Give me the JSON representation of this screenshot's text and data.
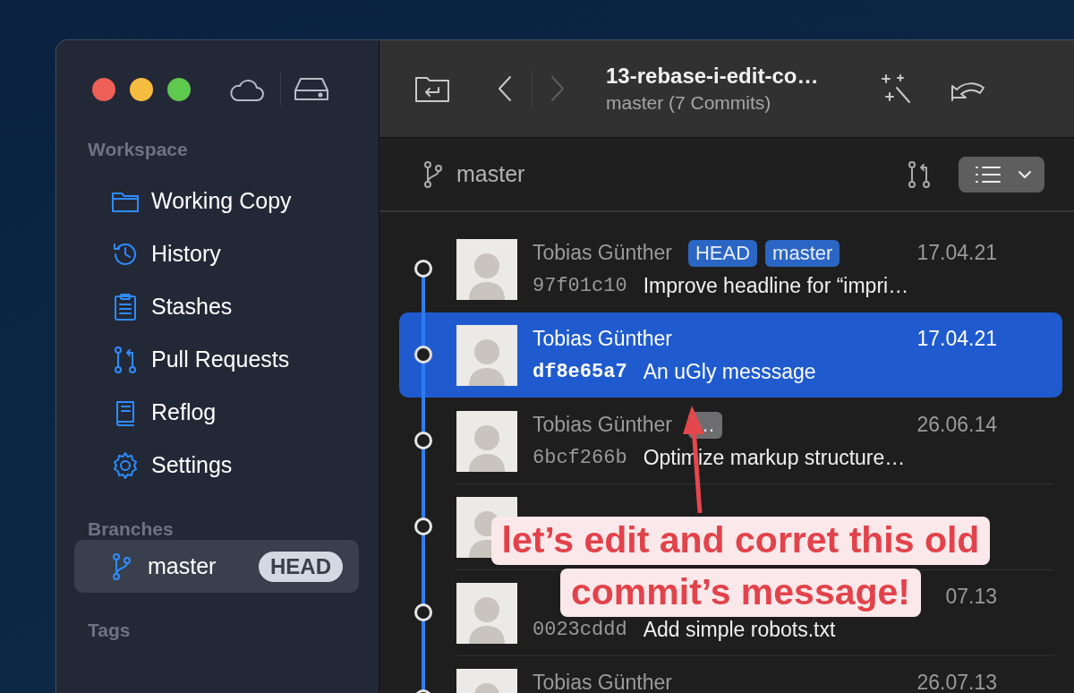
{
  "window": {
    "title": "13-rebase-i-edit-co…",
    "subtitle": "master (7 Commits)"
  },
  "toolbar": {
    "buttons": [
      {
        "kind": "folder-return"
      },
      {
        "kind": "back",
        "disabled": false
      },
      {
        "kind": "forward",
        "disabled": true
      },
      {
        "kind": "title"
      },
      {
        "kind": "magic"
      },
      {
        "kind": "undo"
      }
    ]
  },
  "sidebar": {
    "sections": [
      {
        "title": "Workspace",
        "items": [
          {
            "label": "Working Copy",
            "kind": "folder",
            "selected": false
          },
          {
            "label": "History",
            "kind": "history",
            "selected": false
          },
          {
            "label": "Stashes",
            "kind": "clipboard",
            "selected": false
          },
          {
            "label": "Pull Requests",
            "kind": "pull",
            "selected": false
          },
          {
            "label": "Reflog",
            "kind": "book",
            "selected": false
          },
          {
            "label": "Settings",
            "kind": "gear",
            "selected": false
          }
        ]
      },
      {
        "title": "Branches",
        "items": [
          {
            "label": "master",
            "kind": "branch",
            "badge": "HEAD",
            "selected": true
          }
        ]
      },
      {
        "title": "Tags"
      }
    ]
  },
  "branch_bar": {
    "branch": "master"
  },
  "commits": [
    {
      "author": "Tobias Günther",
      "tags": [
        {
          "label": "HEAD",
          "color": "#2b66c4"
        },
        {
          "label": "master",
          "color": "#2b66c4"
        }
      ],
      "date": "17.04.21",
      "hash": "97f01c10",
      "message": "Improve headline for “impri…",
      "selected": false
    },
    {
      "author": "Tobias Günther",
      "date": "17.04.21",
      "hash": "df8e65a7",
      "message": "An uGly messsage",
      "selected": true
    },
    {
      "author": "Tobias Günther",
      "tags": [
        {
          "label": "…",
          "color": "#6e6e70"
        }
      ],
      "date": "26.06.14",
      "hash": "6bcf266b",
      "message": "Optimize markup structure…",
      "selected": false
    },
    {
      "selected": false
    },
    {
      "date": "07.13",
      "hash": "0023cddd",
      "message": "Add simple robots.txt",
      "selected": false
    },
    {
      "author": "Tobias Günther",
      "date": "26.07.13",
      "selected": false
    }
  ],
  "annotation": {
    "lines": [
      "let’s edit and corret this old",
      "commit’s message!"
    ]
  }
}
